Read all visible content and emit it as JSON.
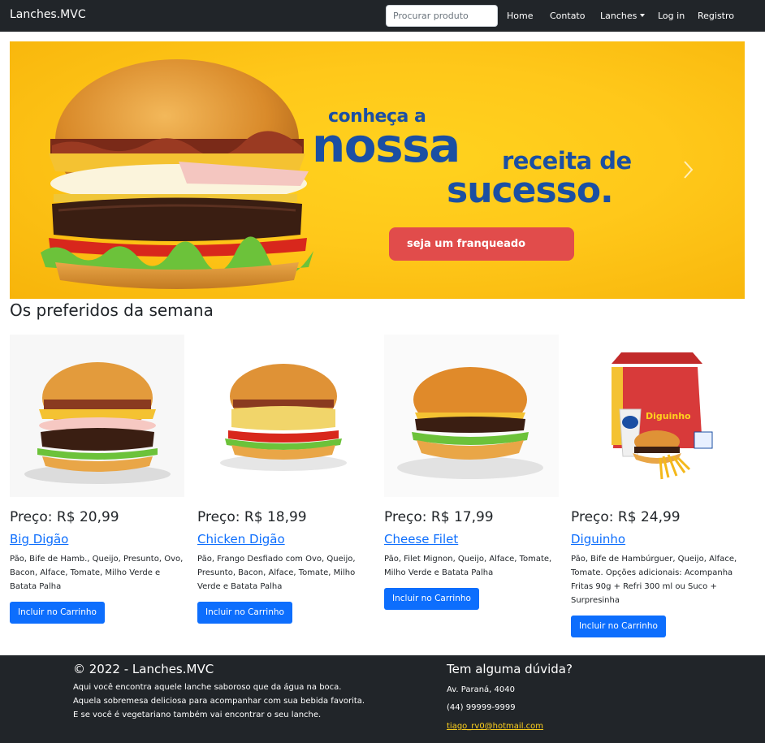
{
  "navbar": {
    "brand": "Lanches.MVC",
    "search_placeholder": "Procurar produto",
    "links": [
      "Home",
      "Contato",
      "Lanches",
      "Log in",
      "Registro"
    ]
  },
  "hero": {
    "line1": "conheça a",
    "line2": "nossa",
    "line3": "receita de",
    "line4": "sucesso.",
    "button": "seja um franqueado",
    "colors": {
      "background": "#ffc81a",
      "text": "#1b4fa3",
      "button": "#e14c4b"
    }
  },
  "section_title": "Os preferidos da semana",
  "products": [
    {
      "price": "Preço: R$ 20,99",
      "name": "Big Digão",
      "description": "Pão, Bife de Hamb., Queijo, Presunto, Ovo, Bacon, Alface, Tomate, Milho Verde e Batata Palha",
      "button": "Incluir no Carrinho"
    },
    {
      "price": "Preço: R$ 18,99",
      "name": "Chicken Digão",
      "description": "Pão, Frango Desfiado com Ovo, Queijo, Presunto, Bacon, Alface, Tomate, Milho Verde e Batata Palha",
      "button": "Incluir no Carrinho"
    },
    {
      "price": "Preço: R$ 17,99",
      "name": "Cheese Filet",
      "description": "Pão, Filet Mignon, Queijo, Alface, Tomate, Milho Verde e Batata Palha",
      "button": "Incluir no Carrinho"
    },
    {
      "price": "Preço: R$ 24,99",
      "name": "Diguinho",
      "description": "Pão, Bife de Hambúrguer, Queijo, Alface, Tomate. Opções adicionais: Acompanha Fritas 90g + Refri 300 ml ou Suco + Surpresinha",
      "button": "Incluir no Carrinho",
      "box_label": "Diguinho"
    }
  ],
  "footer": {
    "copyright": "© 2022 - Lanches.MVC",
    "lines": [
      "Aqui você encontra aquele lanche saboroso que da água na boca.",
      "Aquela sobremesa deliciosa para acompanhar com sua bebida favorita.",
      "E se você é vegetariano também vai encontrar o seu lanche."
    ],
    "contact_title": "Tem alguma dúvida?",
    "address": "Av. Paraná, 4040",
    "phone": "(44) 99999-9999",
    "email": "tiago_rv0@hotmail.com"
  },
  "colors": {
    "navbar": "#212529",
    "primary": "#0d6efd",
    "link_footer": "#ffd21e"
  }
}
